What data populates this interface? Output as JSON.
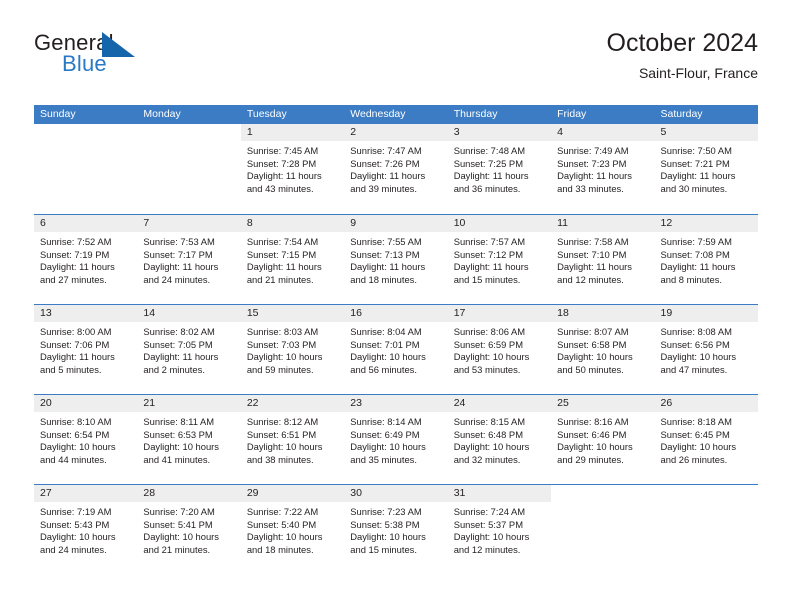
{
  "brand": {
    "name_part1": "General",
    "name_part2": "Blue",
    "flag_icon": "blue-flag-triangle",
    "accent_color": "#2a79c4"
  },
  "header": {
    "title": "October 2024",
    "subtitle": "Saint-Flour, France"
  },
  "calendar": {
    "header_color": "#3b7cc4",
    "daynum_band_color": "#eeeeee",
    "weekdays": [
      "Sunday",
      "Monday",
      "Tuesday",
      "Wednesday",
      "Thursday",
      "Friday",
      "Saturday"
    ],
    "labels": {
      "sunrise": "Sunrise:",
      "sunset": "Sunset:",
      "daylight": "Daylight:"
    },
    "weeks": [
      [
        {
          "day": "",
          "blank": true
        },
        {
          "day": "",
          "blank": true
        },
        {
          "day": "1",
          "sunrise": "Sunrise: 7:45 AM",
          "sunset": "Sunset: 7:28 PM",
          "daylight": "Daylight: 11 hours and 43 minutes."
        },
        {
          "day": "2",
          "sunrise": "Sunrise: 7:47 AM",
          "sunset": "Sunset: 7:26 PM",
          "daylight": "Daylight: 11 hours and 39 minutes."
        },
        {
          "day": "3",
          "sunrise": "Sunrise: 7:48 AM",
          "sunset": "Sunset: 7:25 PM",
          "daylight": "Daylight: 11 hours and 36 minutes."
        },
        {
          "day": "4",
          "sunrise": "Sunrise: 7:49 AM",
          "sunset": "Sunset: 7:23 PM",
          "daylight": "Daylight: 11 hours and 33 minutes."
        },
        {
          "day": "5",
          "sunrise": "Sunrise: 7:50 AM",
          "sunset": "Sunset: 7:21 PM",
          "daylight": "Daylight: 11 hours and 30 minutes."
        }
      ],
      [
        {
          "day": "6",
          "sunrise": "Sunrise: 7:52 AM",
          "sunset": "Sunset: 7:19 PM",
          "daylight": "Daylight: 11 hours and 27 minutes."
        },
        {
          "day": "7",
          "sunrise": "Sunrise: 7:53 AM",
          "sunset": "Sunset: 7:17 PM",
          "daylight": "Daylight: 11 hours and 24 minutes."
        },
        {
          "day": "8",
          "sunrise": "Sunrise: 7:54 AM",
          "sunset": "Sunset: 7:15 PM",
          "daylight": "Daylight: 11 hours and 21 minutes."
        },
        {
          "day": "9",
          "sunrise": "Sunrise: 7:55 AM",
          "sunset": "Sunset: 7:13 PM",
          "daylight": "Daylight: 11 hours and 18 minutes."
        },
        {
          "day": "10",
          "sunrise": "Sunrise: 7:57 AM",
          "sunset": "Sunset: 7:12 PM",
          "daylight": "Daylight: 11 hours and 15 minutes."
        },
        {
          "day": "11",
          "sunrise": "Sunrise: 7:58 AM",
          "sunset": "Sunset: 7:10 PM",
          "daylight": "Daylight: 11 hours and 12 minutes."
        },
        {
          "day": "12",
          "sunrise": "Sunrise: 7:59 AM",
          "sunset": "Sunset: 7:08 PM",
          "daylight": "Daylight: 11 hours and 8 minutes."
        }
      ],
      [
        {
          "day": "13",
          "sunrise": "Sunrise: 8:00 AM",
          "sunset": "Sunset: 7:06 PM",
          "daylight": "Daylight: 11 hours and 5 minutes."
        },
        {
          "day": "14",
          "sunrise": "Sunrise: 8:02 AM",
          "sunset": "Sunset: 7:05 PM",
          "daylight": "Daylight: 11 hours and 2 minutes."
        },
        {
          "day": "15",
          "sunrise": "Sunrise: 8:03 AM",
          "sunset": "Sunset: 7:03 PM",
          "daylight": "Daylight: 10 hours and 59 minutes."
        },
        {
          "day": "16",
          "sunrise": "Sunrise: 8:04 AM",
          "sunset": "Sunset: 7:01 PM",
          "daylight": "Daylight: 10 hours and 56 minutes."
        },
        {
          "day": "17",
          "sunrise": "Sunrise: 8:06 AM",
          "sunset": "Sunset: 6:59 PM",
          "daylight": "Daylight: 10 hours and 53 minutes."
        },
        {
          "day": "18",
          "sunrise": "Sunrise: 8:07 AM",
          "sunset": "Sunset: 6:58 PM",
          "daylight": "Daylight: 10 hours and 50 minutes."
        },
        {
          "day": "19",
          "sunrise": "Sunrise: 8:08 AM",
          "sunset": "Sunset: 6:56 PM",
          "daylight": "Daylight: 10 hours and 47 minutes."
        }
      ],
      [
        {
          "day": "20",
          "sunrise": "Sunrise: 8:10 AM",
          "sunset": "Sunset: 6:54 PM",
          "daylight": "Daylight: 10 hours and 44 minutes."
        },
        {
          "day": "21",
          "sunrise": "Sunrise: 8:11 AM",
          "sunset": "Sunset: 6:53 PM",
          "daylight": "Daylight: 10 hours and 41 minutes."
        },
        {
          "day": "22",
          "sunrise": "Sunrise: 8:12 AM",
          "sunset": "Sunset: 6:51 PM",
          "daylight": "Daylight: 10 hours and 38 minutes."
        },
        {
          "day": "23",
          "sunrise": "Sunrise: 8:14 AM",
          "sunset": "Sunset: 6:49 PM",
          "daylight": "Daylight: 10 hours and 35 minutes."
        },
        {
          "day": "24",
          "sunrise": "Sunrise: 8:15 AM",
          "sunset": "Sunset: 6:48 PM",
          "daylight": "Daylight: 10 hours and 32 minutes."
        },
        {
          "day": "25",
          "sunrise": "Sunrise: 8:16 AM",
          "sunset": "Sunset: 6:46 PM",
          "daylight": "Daylight: 10 hours and 29 minutes."
        },
        {
          "day": "26",
          "sunrise": "Sunrise: 8:18 AM",
          "sunset": "Sunset: 6:45 PM",
          "daylight": "Daylight: 10 hours and 26 minutes."
        }
      ],
      [
        {
          "day": "27",
          "sunrise": "Sunrise: 7:19 AM",
          "sunset": "Sunset: 5:43 PM",
          "daylight": "Daylight: 10 hours and 24 minutes."
        },
        {
          "day": "28",
          "sunrise": "Sunrise: 7:20 AM",
          "sunset": "Sunset: 5:41 PM",
          "daylight": "Daylight: 10 hours and 21 minutes."
        },
        {
          "day": "29",
          "sunrise": "Sunrise: 7:22 AM",
          "sunset": "Sunset: 5:40 PM",
          "daylight": "Daylight: 10 hours and 18 minutes."
        },
        {
          "day": "30",
          "sunrise": "Sunrise: 7:23 AM",
          "sunset": "Sunset: 5:38 PM",
          "daylight": "Daylight: 10 hours and 15 minutes."
        },
        {
          "day": "31",
          "sunrise": "Sunrise: 7:24 AM",
          "sunset": "Sunset: 5:37 PM",
          "daylight": "Daylight: 10 hours and 12 minutes."
        },
        {
          "day": "",
          "blank": true
        },
        {
          "day": "",
          "blank": true
        }
      ]
    ]
  }
}
